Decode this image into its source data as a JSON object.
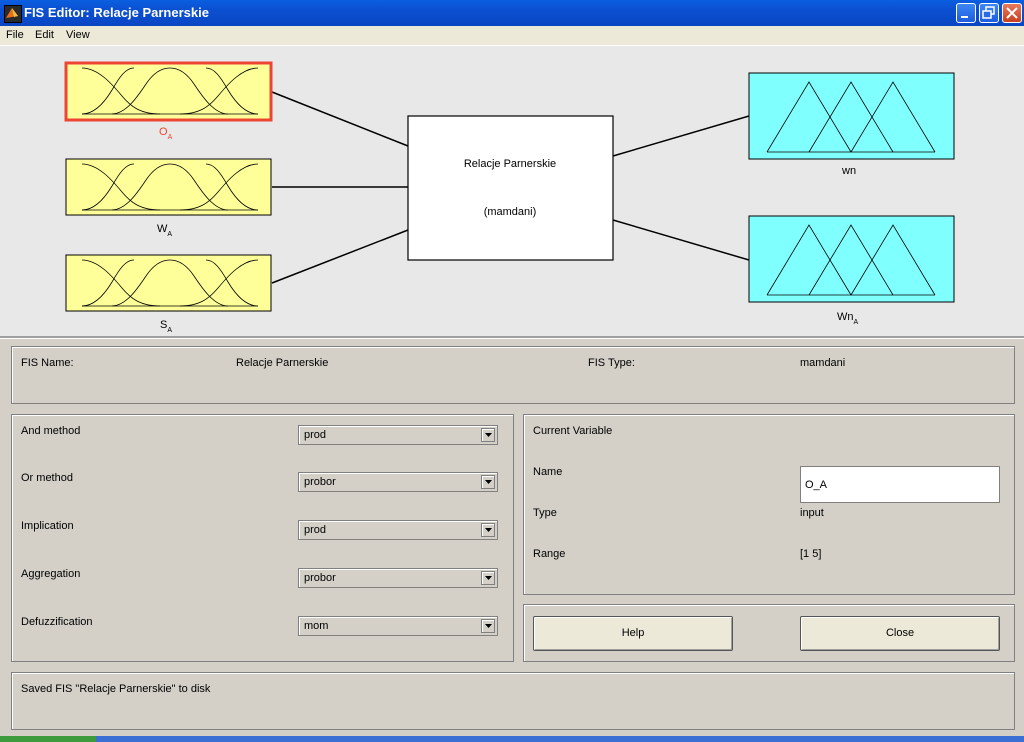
{
  "window": {
    "title": "FIS Editor: Relacje Parnerskie"
  },
  "menu": {
    "items": [
      "File",
      "Edit",
      "View"
    ]
  },
  "diagram": {
    "center_title": "Relacje Parnerskie",
    "center_type": "(mamdani)",
    "inputs": [
      {
        "base": "O",
        "sub": "A",
        "selected": true
      },
      {
        "base": "W",
        "sub": "A",
        "selected": false
      },
      {
        "base": "S",
        "sub": "A",
        "selected": false
      }
    ],
    "outputs": [
      {
        "base": "wn",
        "sub": ""
      },
      {
        "base": "Wn",
        "sub": "A"
      }
    ],
    "colors": {
      "input_fill": "#ffff99",
      "output_fill": "#80ffff",
      "selected_border": "#ee4433",
      "selected_label": "#ee4433"
    }
  },
  "fis_info": {
    "name_label": "FIS Name:",
    "name_value": "Relacje Parnerskie",
    "type_label": "FIS Type:",
    "type_value": "mamdani"
  },
  "methods": [
    {
      "label": "And method",
      "value": "prod"
    },
    {
      "label": "Or method",
      "value": "probor"
    },
    {
      "label": "Implication",
      "value": "prod"
    },
    {
      "label": "Aggregation",
      "value": "probor"
    },
    {
      "label": "Defuzzification",
      "value": "mom"
    }
  ],
  "current_variable": {
    "heading": "Current Variable",
    "name_label": "Name",
    "name_value": "O_A",
    "type_label": "Type",
    "type_value": "input",
    "range_label": "Range",
    "range_value": "[1 5]"
  },
  "buttons": {
    "help": "Help",
    "close": "Close"
  },
  "status": {
    "text": "Saved FIS \"Relacje Parnerskie\" to disk"
  }
}
